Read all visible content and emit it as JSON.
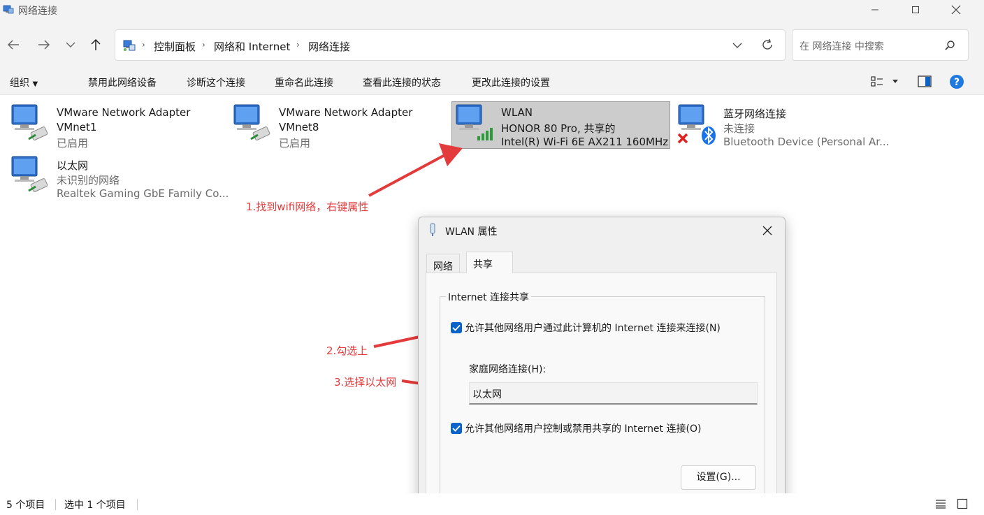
{
  "window": {
    "title": "网络连接"
  },
  "address": {
    "crumbs": [
      "控制面板",
      "网络和 Internet",
      "网络连接"
    ],
    "search_placeholder": "在 网络连接 中搜索"
  },
  "commands": [
    "组织",
    "禁用此网络设备",
    "诊断这个连接",
    "重命名此连接",
    "查看此连接的状态",
    "更改此连接的设置"
  ],
  "items": [
    {
      "name": "VMware Network Adapter",
      "line2": "VMnet1",
      "line3": "已启用"
    },
    {
      "name": "VMware Network Adapter",
      "line2": "VMnet8",
      "line3": "已启用"
    },
    {
      "name": "WLAN",
      "line2": "HONOR 80 Pro, 共享的",
      "line3": "Intel(R) Wi-Fi 6E AX211 160MHz",
      "selected": true
    },
    {
      "name": "蓝牙网络连接",
      "line2": "未连接",
      "line3": "Bluetooth Device (Personal Ar..."
    },
    {
      "name": "以太网",
      "line2": "未识别的网络",
      "line3": "Realtek Gaming GbE Family Co..."
    }
  ],
  "status": {
    "count": "5 个项目",
    "selection": "选中 1 个项目"
  },
  "annotations": {
    "step1": "1.找到wifi网络，右键属性",
    "step2": "2.勾选上",
    "step3": "3.选择以太网",
    "color": "#e33b3b"
  },
  "dialog": {
    "title": "WLAN 属性",
    "tabs": [
      "网络",
      "共享"
    ],
    "active_tab": "共享",
    "group_title": "Internet 连接共享",
    "allow_connect_label": "允许其他网络用户通过此计算机的 Internet 连接来连接(N)",
    "allow_connect_checked": true,
    "home_network_label": "家庭网络连接(H):",
    "home_network_value": "以太网",
    "allow_control_label": "允许其他网络用户控制或禁用共享的 Internet 连接(O)",
    "allow_control_checked": true,
    "settings_button": "设置(G)..."
  },
  "colors": {
    "accent": "#0a63c8",
    "selection_bg": "#cccccc",
    "chrome_bg": "#f3f3f3"
  }
}
